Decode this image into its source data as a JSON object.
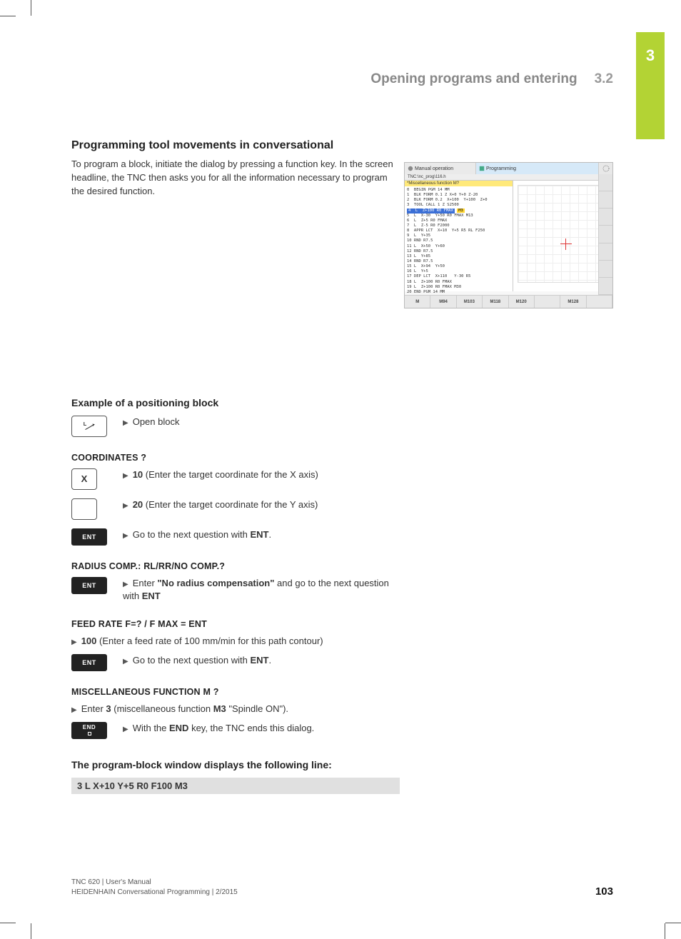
{
  "tab": {
    "chapter": "3"
  },
  "header": {
    "title": "Opening programs and entering",
    "section": "3.2"
  },
  "intro": {
    "heading": "Programming tool movements in conversational",
    "para": "To program a block, initiate the dialog by pressing a function key. In the screen headline, the TNC then asks you for all the information necessary to program the desired function."
  },
  "screenshot": {
    "mode1": "Manual operation",
    "mode2": "Programming",
    "sub": "TNC:\\nc_prog\\116.h",
    "yellow": "*Miscellaneous function M?",
    "code": "0  BEGIN PGM 14 MM\n1  BLK FORM 0.1 Z X+0 Y+0 Z-20\n2  BLK FORM 0.2  X+100  Y+100  Z+0\n3  TOOL CALL 1 Z S2500",
    "hl_line": "4  L  Z+100 R0 FMAX",
    "hl_suffix": "M3",
    "code2": "5  L  X-30  Y+50 R0 FMAX M13\n6  L  Z+5 R0 FMAX\n7  L  Z-5 R0 F2000\n8  APPR LCT  X+10  Y+5 R5 RL F250\n9  L  Y+35\n10 RND R7.5\n11 L  X+50  Y+60\n12 RND R7.5\n13 L  Y+85\n14 RND R7.5\n15 L  X+94  Y+50\n16 L  Y+5\n17 DEP LCT  X+110   Y-30 R5\n18 L  Z+100 R0 FMAX\n19 L  Z+100 R0 FMAX M30\n20 END PGM 14 MM",
    "softkeys": [
      "M",
      "M94",
      "M103",
      "M118",
      "M120",
      "",
      "M128",
      ""
    ]
  },
  "example_heading": "Example of a positioning block",
  "step_open": "Open block",
  "coords": {
    "prompt": "COORDINATES ?",
    "x_key": "X",
    "step_x_b": "10",
    "step_x": " (Enter the target coordinate for the X axis)",
    "step_y_b": "20",
    "step_y": " (Enter the target coordinate for the Y axis)",
    "step_ent_pre": "Go to the next question with ",
    "step_ent_b": "ENT",
    "step_ent_post": "."
  },
  "radius": {
    "prompt": "RADIUS COMP.: RL/RR/NO COMP.?",
    "step_pre": "Enter ",
    "step_b1": "\"No radius compensation\"",
    "step_mid": " and go to the next question with ",
    "step_b2": "ENT"
  },
  "feed": {
    "prompt": "FEED RATE F=? / F MAX = ENT",
    "line_b": "100",
    "line": " (Enter a feed rate of 100 mm/min for this path contour)",
    "step_pre": "Go to the next question with ",
    "step_b": "ENT",
    "step_post": "."
  },
  "misc": {
    "prompt": "MISCELLANEOUS FUNCTION M ?",
    "line_pre": "Enter ",
    "line_b1": "3",
    "line_mid": " (miscellaneous function ",
    "line_b2": "M3",
    "line_post": " \"Spindle ON\").",
    "step_pre": "With the ",
    "step_b": "END",
    "step_post": " key, the TNC ends this dialog.",
    "end_key_top": "END"
  },
  "result": {
    "heading": "The program-block window displays the following line:",
    "code": "3 L X+10 Y+5 R0 F100 M3"
  },
  "footer": {
    "line1": "TNC 620 | User's Manual",
    "line2": "HEIDENHAIN Conversational Programming | 2/2015",
    "page": "103"
  },
  "key_labels": {
    "ent": "ENT"
  }
}
